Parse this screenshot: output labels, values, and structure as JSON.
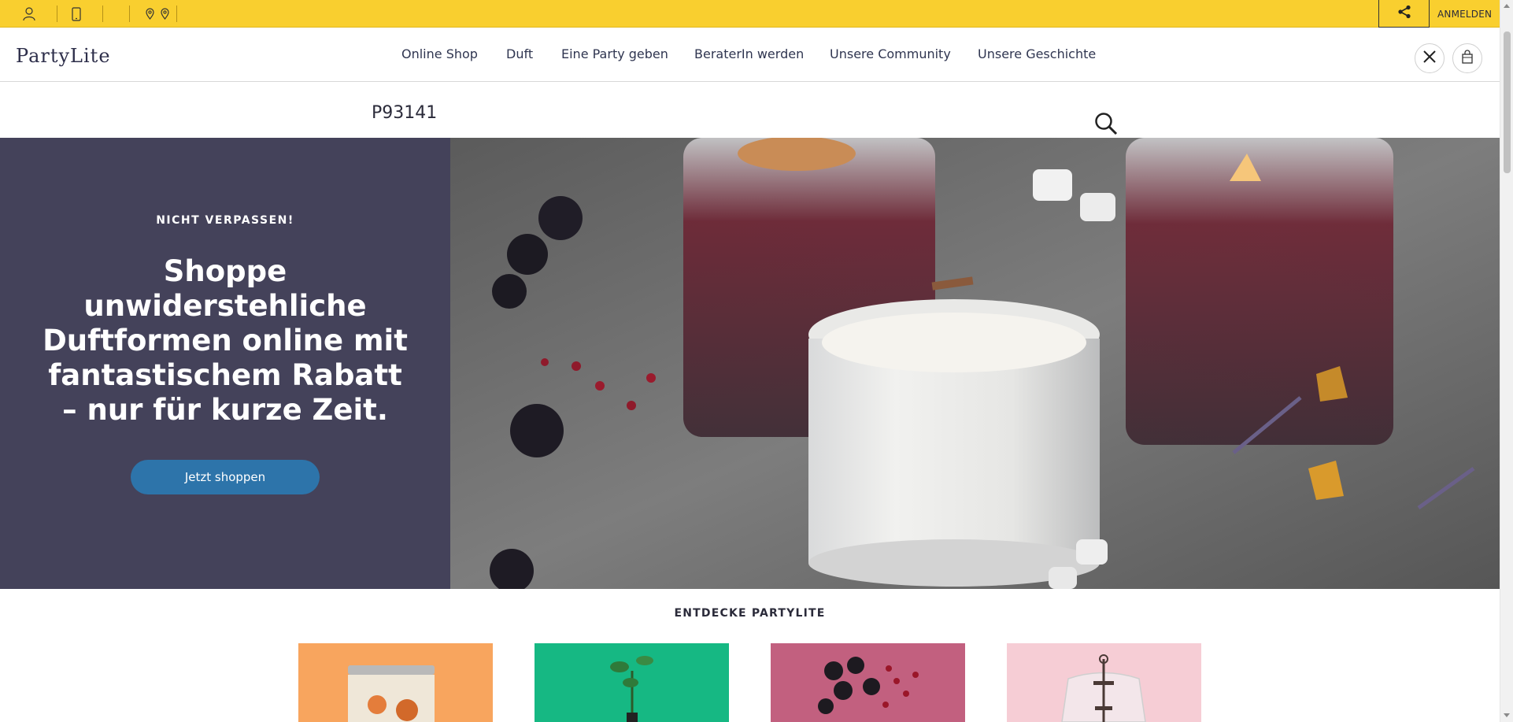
{
  "topbar": {
    "login_label": "ANMELDEN",
    "icons": [
      "user-icon",
      "mobile-icon",
      "map-pin-icon",
      "map-pin-icon",
      "share-icon"
    ]
  },
  "header": {
    "logo_text": "PartyLite",
    "nav": [
      "Online Shop",
      "Duft",
      "Eine Party geben",
      "BeraterIn werden",
      "Unsere Community",
      "Unsere Geschichte"
    ],
    "icons": [
      "close-icon",
      "shopping-bag-icon"
    ]
  },
  "search": {
    "value": "P93141"
  },
  "hero": {
    "eyebrow": "NICHT VERPASSEN!",
    "title": "Shoppe unwiderstehliche Duftformen online mit fantastischem Rabatt – nur für kurze Zeit.",
    "button_label": "Jetzt shoppen",
    "bg_color": "#44425a",
    "button_color": "#2d74aa"
  },
  "discover": {
    "title": "ENTDECKE PARTYLITE",
    "tiles": [
      {
        "color": "#f8a55e"
      },
      {
        "color": "#16b883"
      },
      {
        "color": "#c2607f"
      },
      {
        "color": "#f6cdd5"
      }
    ]
  },
  "colors": {
    "topbar": "#f9cf2f",
    "nav_text": "#2f3550"
  }
}
